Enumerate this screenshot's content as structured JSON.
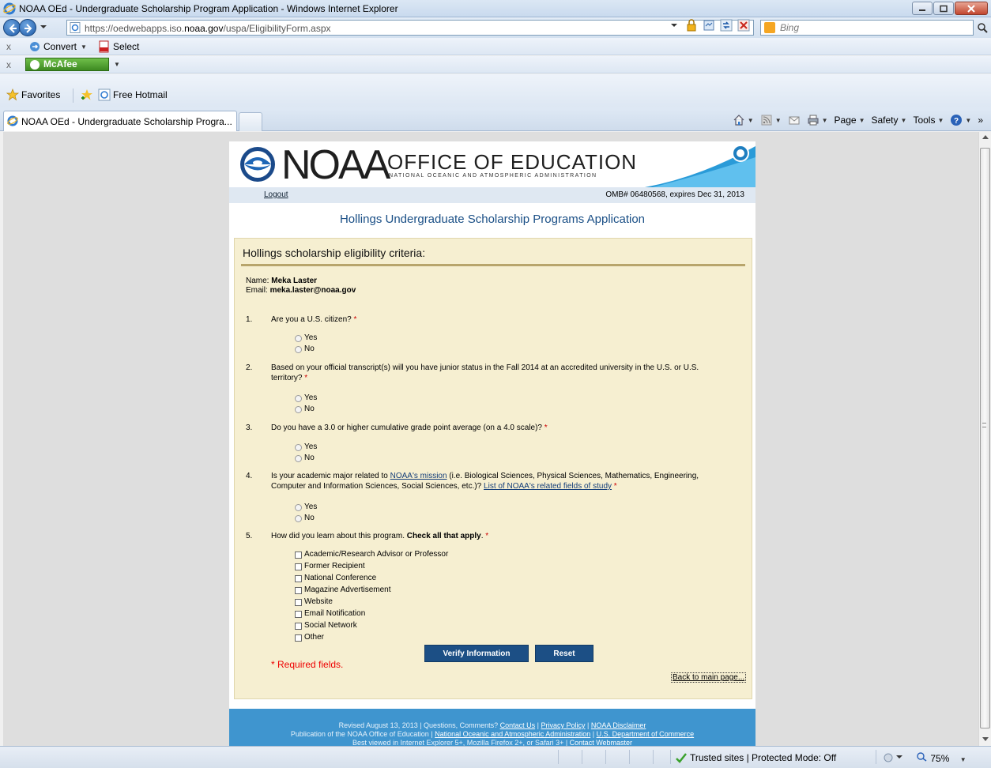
{
  "browser": {
    "window_title": "NOAA OEd - Undergraduate Scholarship Program Application - Windows Internet Explorer",
    "url_prefix": "https://oedwebapps.iso.",
    "url_domain": "noaa.gov",
    "url_path": "/uspa/EligibilityForm.aspx",
    "search_placeholder": "Bing",
    "toolbar1": {
      "close": "x",
      "convert": "Convert",
      "select": "Select"
    },
    "toolbar2": {
      "close": "x",
      "mcafee": "McAfee"
    },
    "favorites": {
      "label": "Favorites",
      "link": "Free Hotmail"
    },
    "tab_title": "NOAA OEd - Undergraduate Scholarship Progra...",
    "commands": {
      "page": "Page",
      "safety": "Safety",
      "tools": "Tools",
      "more": "»"
    },
    "status": {
      "zone": "Trusted sites | Protected Mode: Off",
      "zoom": "75%"
    }
  },
  "page": {
    "logo_word": "NOAA",
    "office_title": "OFFICE OF EDUCATION",
    "office_subtitle": "NATIONAL OCEANIC AND ATMOSPHERIC ADMINISTRATION",
    "logout": "Logout",
    "omb": "OMB# 06480568, expires Dec 31, 2013",
    "title": "Hollings Undergraduate Scholarship Programs Application",
    "section_head": "Hollings scholarship eligibility criteria:",
    "name_label": "Name:",
    "name_value": "Meka Laster",
    "email_label": "Email:",
    "email_value": "meka.laster@noaa.gov",
    "required_mark": "*",
    "questions": [
      {
        "num": "1.",
        "text": "Are you a U.S. citizen?"
      },
      {
        "num": "2.",
        "text": "Based on your official transcript(s) will you have junior status in the Fall 2014 at an accredited university in the U.S. or U.S. territory?"
      },
      {
        "num": "3.",
        "text": "Do you have a 3.0 or higher cumulative grade point average (on a 4.0 scale)?"
      },
      {
        "num": "4.",
        "text_before": "Is your academic major related to ",
        "link1": "NOAA's mission",
        "text_mid": " (i.e. Biological Sciences, Physical Sciences, Mathematics, Engineering, Computer and Information Sciences, Social Sciences, etc.)? ",
        "link2": "List of NOAA's related fields of study"
      },
      {
        "num": "5.",
        "text_before": "How did you learn about this program. ",
        "text_bold": "Check all that apply",
        "text_after": "."
      }
    ],
    "yes": "Yes",
    "no": "No",
    "sources": [
      "Academic/Research Advisor or Professor",
      "Former Recipient",
      "National Conference",
      "Magazine Advertisement",
      "Website",
      "Email Notification",
      "Social Network",
      "Other"
    ],
    "verify_button": "Verify Information",
    "reset_button": "Reset",
    "required_note": "* Required fields.",
    "back_link": "Back to main page...",
    "footer": {
      "line1_text": "Revised August 13, 2013 | Questions, Comments? ",
      "contact": "Contact Us",
      "privacy": "Privacy Policy",
      "disclaimer": "NOAA Disclaimer",
      "line2_text": "Publication of the NOAA Office of Education | ",
      "noaa_link": "National Oceanic and Atmospheric Administration",
      "doc_link": "U.S. Department of Commerce",
      "line3_text": "Best viewed in Internet Explorer 5+, Mozilla Firefox 2+, or Safari 3+ | ",
      "webmaster": "Contact Webmaster",
      "sep": " | "
    }
  }
}
